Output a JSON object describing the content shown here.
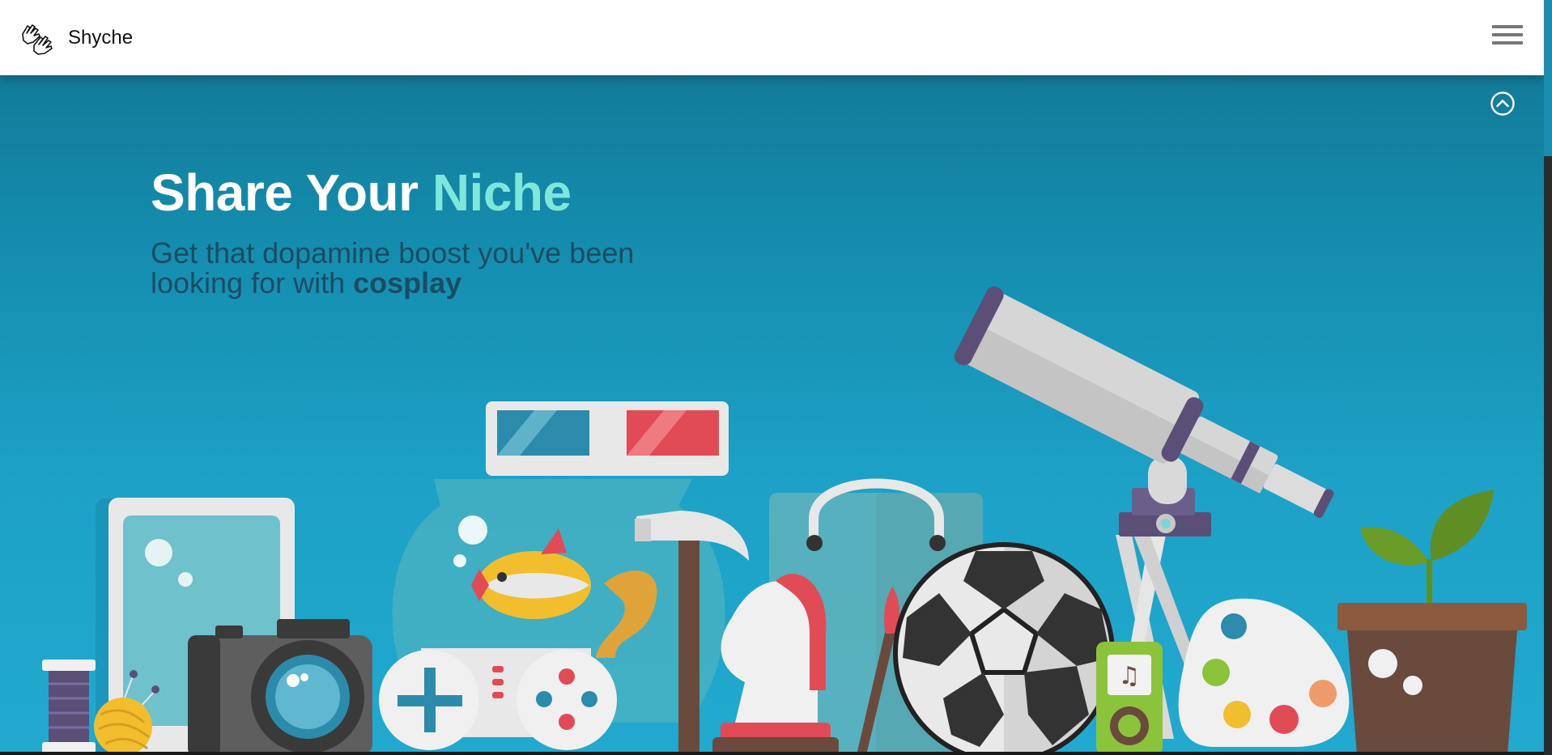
{
  "navbar": {
    "brand_name": "Shyche",
    "logo_icon": "hands-icon",
    "menu_icon": "hamburger-menu-icon"
  },
  "hero": {
    "title_main": "Share Your ",
    "title_accent": "Niche",
    "subtitle_text": "Get that dopamine boost you've been looking for with ",
    "subtitle_keyword": "cosplay",
    "scroll_icon": "chevron-up-circle-icon",
    "illustration_items": [
      "thread-spool-icon",
      "yarn-ball-icon",
      "tablet-icon",
      "camera-icon",
      "fishbowl-icon",
      "goldfish-icon",
      "3d-glasses-icon",
      "game-controller-icon",
      "hammer-icon",
      "chess-knight-icon",
      "shopping-bag-icon",
      "paintbrush-icon",
      "soccer-ball-icon",
      "music-player-icon",
      "telescope-icon",
      "paint-palette-icon",
      "potted-plant-icon"
    ]
  },
  "colors": {
    "navbar_bg": "#ffffff",
    "hero_top": "#127b9a",
    "hero_bottom": "#22a9cf",
    "title": "#ffffff",
    "title_accent": "#7ee7db",
    "subtitle": "#1b4c66"
  }
}
